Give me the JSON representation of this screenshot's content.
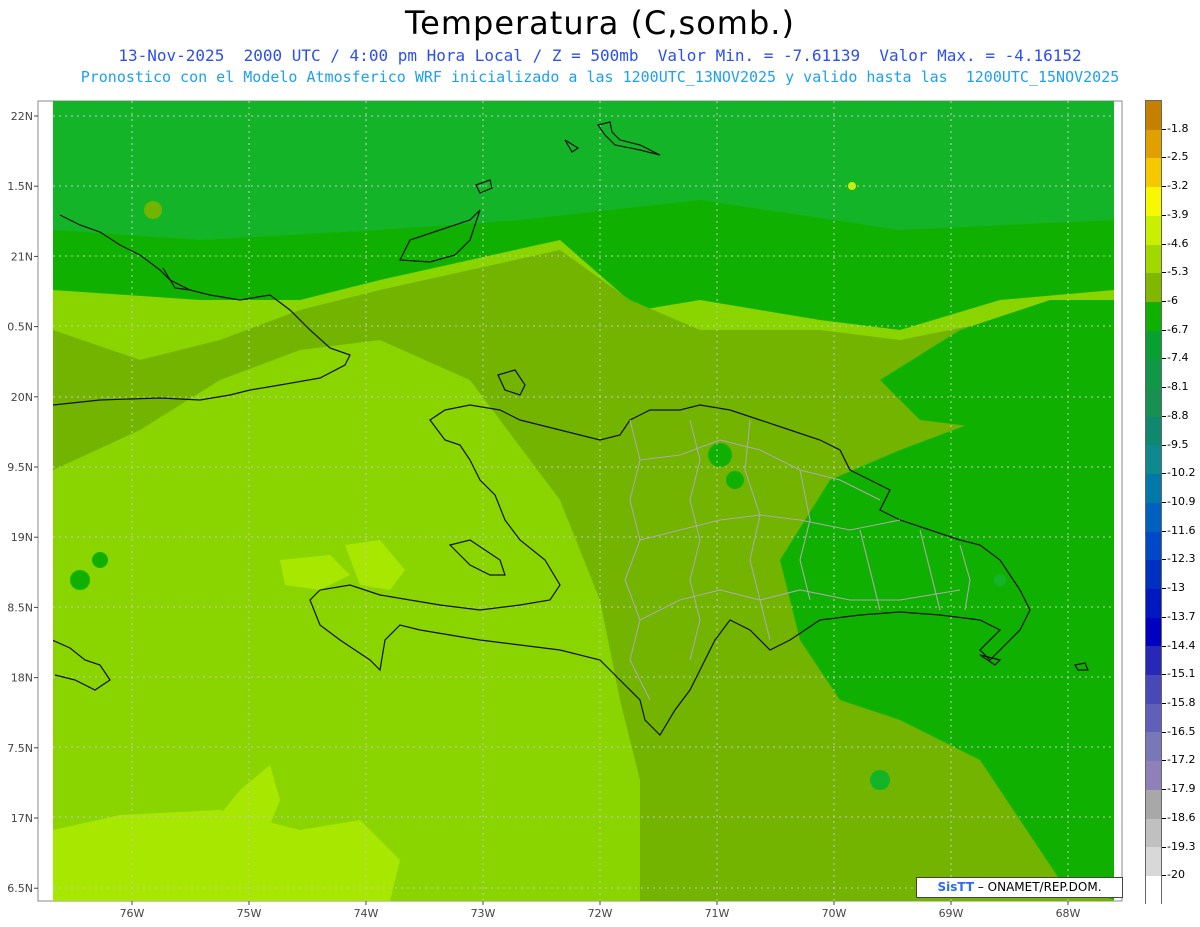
{
  "title": "Temperatura (C,somb.)",
  "subtitle_line1": "13-Nov-2025  2000 UTC / 4:00 pm Hora Local / Z = 500mb  Valor Min. = -7.61139  Valor Max. = -4.16152",
  "subtitle_line2": "Pronostico con el Modelo Atmosferico WRF inicializado a las 1200UTC_13NOV2025 y valido hasta las  1200UTC_15NOV2025",
  "colors": {
    "title": "#000000",
    "subtitle1": "#2b4ef5",
    "subtitle2": "#1ea0f0",
    "coast": "#111111",
    "provinces": "#aaaaaa",
    "grid": "#c8c8c8"
  },
  "map": {
    "lat_ticks": [
      "22N",
      "1.5N",
      "21N",
      "0.5N",
      "20N",
      "9.5N",
      "19N",
      "8.5N",
      "18N",
      "7.5N",
      "17N",
      "6.5N"
    ],
    "lon_ticks": [
      "76W",
      "75W",
      "74W",
      "73W",
      "72W",
      "71W",
      "70W",
      "69W",
      "68W"
    ]
  },
  "colorbar": {
    "labels": [
      "-1.8",
      "-2.5",
      "-3.2",
      "-3.9",
      "-4.6",
      "-5.3",
      "-6",
      "-6.7",
      "-7.4",
      "-8.1",
      "-8.8",
      "-9.5",
      "-10.2",
      "-10.9",
      "-11.6",
      "-12.3",
      "-13",
      "-13.7",
      "-14.4",
      "-15.1",
      "-15.8",
      "-16.5",
      "-17.2",
      "-17.9",
      "-18.6",
      "-19.3",
      "-20"
    ],
    "colors": [
      "#c68000",
      "#e0a000",
      "#f5c800",
      "#f8f800",
      "#c8f000",
      "#a0d800",
      "#80b800",
      "#10b000",
      "#08a030",
      "#109848",
      "#189050",
      "#108870",
      "#108890",
      "#0078a8",
      "#0060c0",
      "#0048c8",
      "#0030c0",
      "#0018c0",
      "#0000c0",
      "#2828b8",
      "#4848b8",
      "#6060b8",
      "#7878b8",
      "#9080b8",
      "#a8a8a8",
      "#c0c0c0",
      "#d8d8d8",
      "#ffffff"
    ]
  },
  "credit": {
    "brand": "SisTT",
    "text": "– ONAMET/REP.DOM."
  }
}
